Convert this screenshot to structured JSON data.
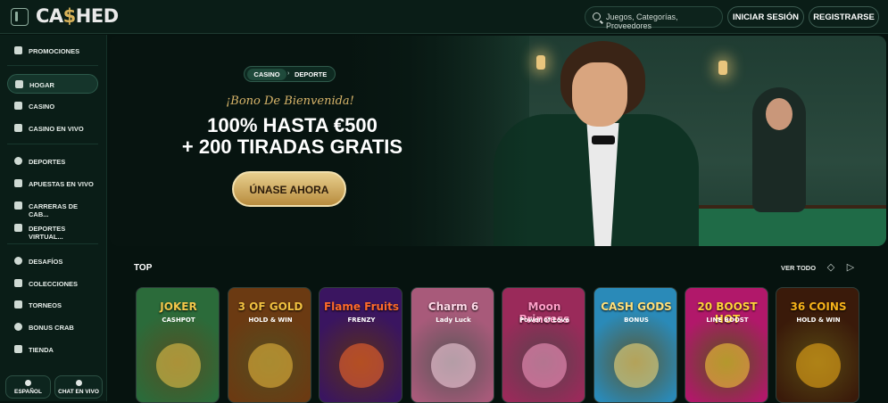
{
  "header": {
    "logo_left": "CA",
    "logo_mid": "$",
    "logo_right": "HED",
    "search_placeholder": "Juegos, Categorías, Proveedores",
    "login_label": "INICIAR SESIÓN",
    "register_label": "REGISTRARSE"
  },
  "sidebar": {
    "items": [
      {
        "label": "PROMOCIONES",
        "icon": "gift-icon"
      },
      {
        "label": "HOGAR",
        "icon": "home-icon",
        "active": true
      },
      {
        "label": "CASINO",
        "icon": "card-icon"
      },
      {
        "label": "CASINO EN VIVO",
        "icon": "live-cards-icon"
      },
      {
        "label": "DEPORTES",
        "icon": "ball-icon"
      },
      {
        "label": "APUESTAS EN VIVO",
        "icon": "live-bet-icon"
      },
      {
        "label": "CARRERAS DE CAB...",
        "icon": "horse-icon"
      },
      {
        "label": "DEPORTES VIRTUAL...",
        "icon": "virtual-icon"
      },
      {
        "label": "DESAFÍOS",
        "icon": "target-icon"
      },
      {
        "label": "COLECCIONES",
        "icon": "collection-icon"
      },
      {
        "label": "TORNEOS",
        "icon": "trophy-icon"
      },
      {
        "label": "BONUS CRAB",
        "icon": "crab-icon"
      },
      {
        "label": "TIENDA",
        "icon": "shop-icon"
      }
    ],
    "language_label": "ESPAÑOL",
    "chat_label": "CHAT EN VIVO"
  },
  "hero": {
    "tab_casino": "CASINO",
    "tab_sport": "DEPORTE",
    "subtitle": "¡Bono De Bienvenida!",
    "line1": "100% HASTA €500",
    "line2": "+ 200 TIRADAS GRATIS",
    "cta_label": "ÚNASE AHORA"
  },
  "top_section": {
    "title": "TOP",
    "see_all": "VER TODO",
    "games": [
      {
        "title": "JOKER",
        "sub": "CASHPOT",
        "bg": "#2b6b3a",
        "accent": "#f2c84b"
      },
      {
        "title": "3 OF GOLD",
        "sub": "HOLD & WIN",
        "bg": "#6b3a12",
        "accent": "#f0c040"
      },
      {
        "title": "Flame Fruits",
        "sub": "FRENZY",
        "bg": "#3a1560",
        "accent": "#ff6a2b"
      },
      {
        "title": "Charm 6",
        "sub": "Lady Luck",
        "bg": "#a85a7a",
        "accent": "#ffd9e8"
      },
      {
        "title": "Moon Princess",
        "sub": "Power of Love",
        "bg": "#9a2a5a",
        "accent": "#ff9fc8"
      },
      {
        "title": "CASH GODS",
        "sub": "BONUS",
        "bg": "#2a8ab8",
        "accent": "#ffe07a"
      },
      {
        "title": "20 BOOST HOT",
        "sub": "LINE BOOST",
        "bg": "#b1186a",
        "accent": "#ffd23a"
      },
      {
        "title": "36 COINS",
        "sub": "HOLD & WIN",
        "bg": "#3a1a0a",
        "accent": "#f7b21a"
      }
    ]
  },
  "colors": {
    "background": "#06130f",
    "accent_gold": "#d8b25a",
    "panel": "#0a1d17"
  }
}
